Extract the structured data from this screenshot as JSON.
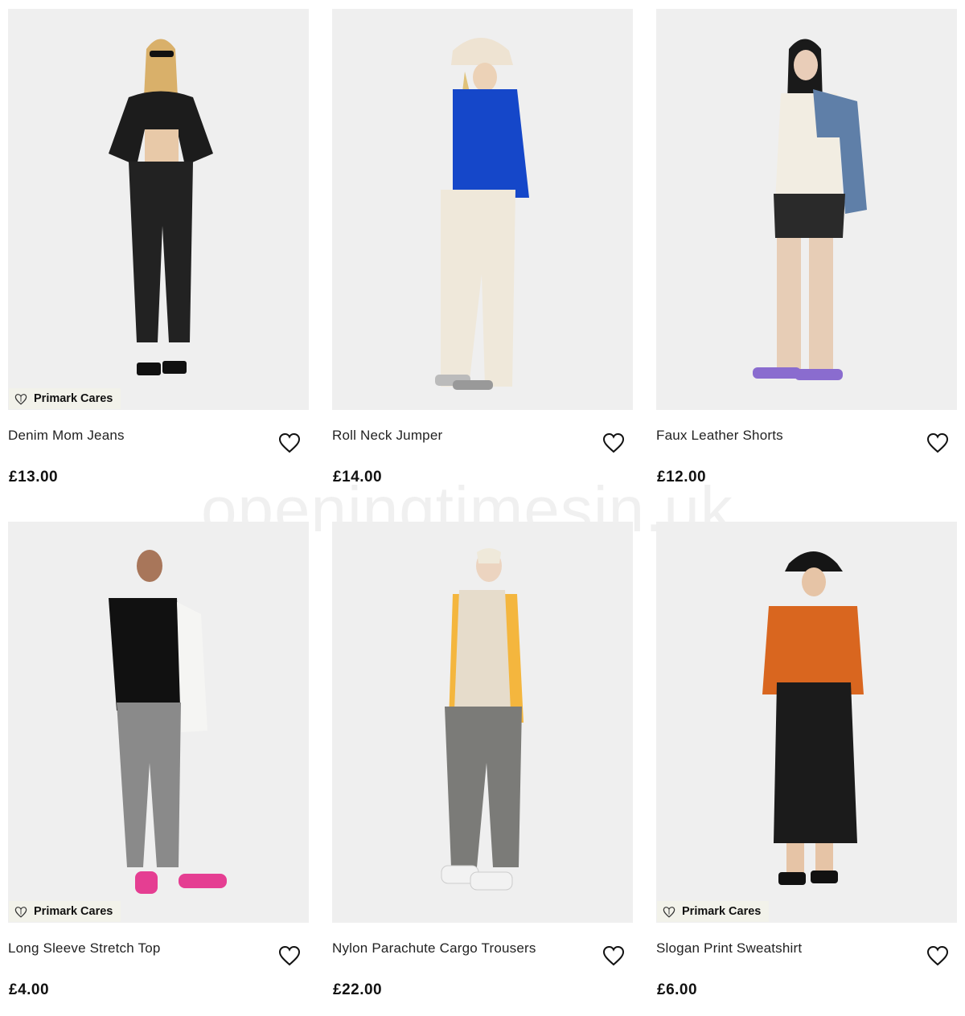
{
  "badge_label": "Primark Cares",
  "watermark": "openingtimesin.uk",
  "products": [
    {
      "name": "Denim Mom Jeans",
      "price": "£13.00",
      "badge": true
    },
    {
      "name": "Roll Neck Jumper",
      "price": "£14.00",
      "badge": false
    },
    {
      "name": "Faux Leather Shorts",
      "price": "£12.00",
      "badge": false
    },
    {
      "name": "Long Sleeve Stretch Top",
      "price": "£4.00",
      "badge": true
    },
    {
      "name": "Nylon Parachute Cargo Trousers",
      "price": "£22.00",
      "badge": false
    },
    {
      "name": "Slogan Print Sweatshirt",
      "price": "£6.00",
      "badge": true
    }
  ],
  "colors": {
    "photo_bg": "#efefef",
    "badge_bg": "#f2f2ea"
  },
  "icons": {
    "wishlist": "heart-outline-icon",
    "badge": "heart-leaf-icon"
  }
}
